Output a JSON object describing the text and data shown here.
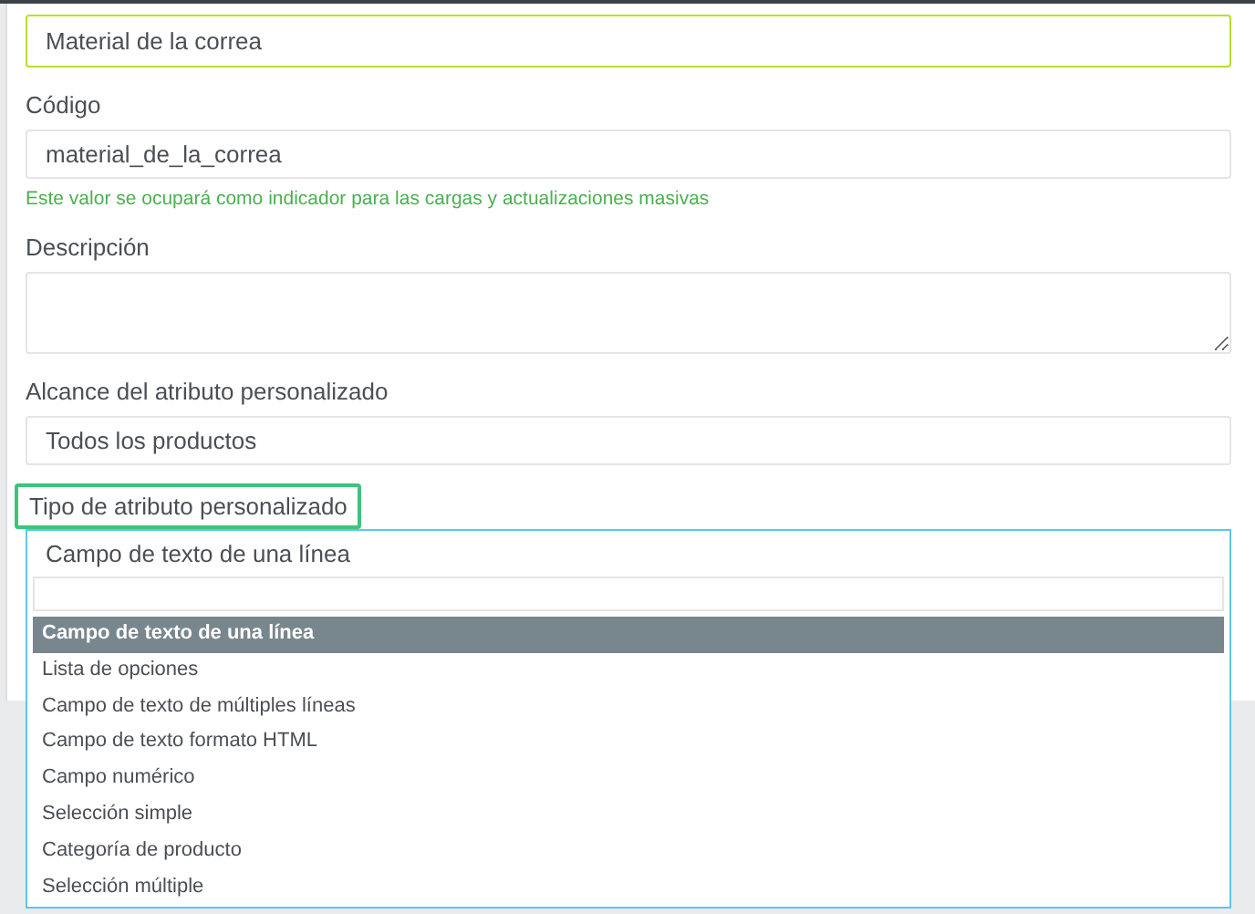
{
  "name_field": {
    "value": "Material de la correa"
  },
  "code": {
    "label": "Código",
    "value": "material_de_la_correa",
    "hint": "Este valor se ocupará como indicador para las cargas y actualizaciones masivas"
  },
  "description": {
    "label": "Descripción"
  },
  "scope": {
    "label": "Alcance del atributo personalizado",
    "value": "Todos los productos"
  },
  "type": {
    "label": "Tipo de atributo personalizado",
    "highlighted": true,
    "value": "Campo de texto de una línea",
    "options": [
      {
        "label": "Campo de texto de una línea",
        "selected": true
      },
      {
        "label": "Lista de opciones",
        "selected": false
      },
      {
        "label": "Campo de texto de múltiples líneas",
        "selected": false
      },
      {
        "label": "Campo de texto formato HTML",
        "selected": false
      },
      {
        "label": "Campo numérico",
        "selected": false
      },
      {
        "label": "Selección simple",
        "selected": false
      },
      {
        "label": "Categoría de producto",
        "selected": false
      },
      {
        "label": "Selección múltiple",
        "selected": false
      }
    ]
  }
}
